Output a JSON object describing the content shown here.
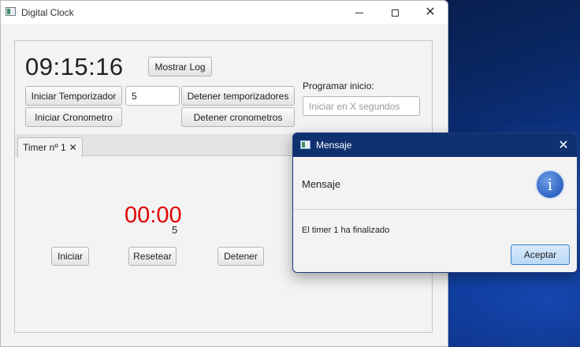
{
  "window": {
    "title": "Digital Clock",
    "icon": "app-window-icon"
  },
  "clock": {
    "time": "09:15:16"
  },
  "toolbar": {
    "show_log": "Mostrar Log",
    "start_timer": "Iniciar Temporizador",
    "timer_seconds_value": "5",
    "stop_timers": "Detener temporizadores",
    "start_stopwatch": "Iniciar Cronometro",
    "stop_stopwatches": "Detener cronometros",
    "schedule_label": "Programar inicio:",
    "schedule_placeholder": "Iniciar en X segundos"
  },
  "tabs": [
    {
      "label": "Timer nº 1",
      "close": "✕"
    }
  ],
  "timer_tab": {
    "display": "00:00",
    "sub_value": "5",
    "start": "Iniciar",
    "reset": "Resetear",
    "stop": "Detener"
  },
  "dialog": {
    "title": "Mensaje",
    "header": "Mensaje",
    "content": "El timer 1 ha finalizado",
    "ok": "Aceptar",
    "icon": "info-icon",
    "icon_glyph": "i"
  },
  "colors": {
    "timer_display": "#e00000",
    "dialog_titlebar": "#0f3170",
    "accent_button": "#b8d8f5"
  }
}
